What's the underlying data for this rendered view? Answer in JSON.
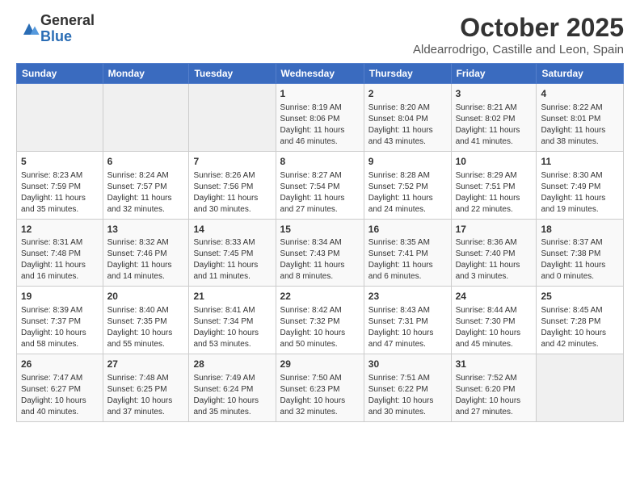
{
  "logo": {
    "general": "General",
    "blue": "Blue"
  },
  "title": "October 2025",
  "subtitle": "Aldearrodrigo, Castille and Leon, Spain",
  "headers": [
    "Sunday",
    "Monday",
    "Tuesday",
    "Wednesday",
    "Thursday",
    "Friday",
    "Saturday"
  ],
  "weeks": [
    [
      {
        "day": "",
        "content": ""
      },
      {
        "day": "",
        "content": ""
      },
      {
        "day": "",
        "content": ""
      },
      {
        "day": "1",
        "content": "Sunrise: 8:19 AM\nSunset: 8:06 PM\nDaylight: 11 hours and 46 minutes."
      },
      {
        "day": "2",
        "content": "Sunrise: 8:20 AM\nSunset: 8:04 PM\nDaylight: 11 hours and 43 minutes."
      },
      {
        "day": "3",
        "content": "Sunrise: 8:21 AM\nSunset: 8:02 PM\nDaylight: 11 hours and 41 minutes."
      },
      {
        "day": "4",
        "content": "Sunrise: 8:22 AM\nSunset: 8:01 PM\nDaylight: 11 hours and 38 minutes."
      }
    ],
    [
      {
        "day": "5",
        "content": "Sunrise: 8:23 AM\nSunset: 7:59 PM\nDaylight: 11 hours and 35 minutes."
      },
      {
        "day": "6",
        "content": "Sunrise: 8:24 AM\nSunset: 7:57 PM\nDaylight: 11 hours and 32 minutes."
      },
      {
        "day": "7",
        "content": "Sunrise: 8:26 AM\nSunset: 7:56 PM\nDaylight: 11 hours and 30 minutes."
      },
      {
        "day": "8",
        "content": "Sunrise: 8:27 AM\nSunset: 7:54 PM\nDaylight: 11 hours and 27 minutes."
      },
      {
        "day": "9",
        "content": "Sunrise: 8:28 AM\nSunset: 7:52 PM\nDaylight: 11 hours and 24 minutes."
      },
      {
        "day": "10",
        "content": "Sunrise: 8:29 AM\nSunset: 7:51 PM\nDaylight: 11 hours and 22 minutes."
      },
      {
        "day": "11",
        "content": "Sunrise: 8:30 AM\nSunset: 7:49 PM\nDaylight: 11 hours and 19 minutes."
      }
    ],
    [
      {
        "day": "12",
        "content": "Sunrise: 8:31 AM\nSunset: 7:48 PM\nDaylight: 11 hours and 16 minutes."
      },
      {
        "day": "13",
        "content": "Sunrise: 8:32 AM\nSunset: 7:46 PM\nDaylight: 11 hours and 14 minutes."
      },
      {
        "day": "14",
        "content": "Sunrise: 8:33 AM\nSunset: 7:45 PM\nDaylight: 11 hours and 11 minutes."
      },
      {
        "day": "15",
        "content": "Sunrise: 8:34 AM\nSunset: 7:43 PM\nDaylight: 11 hours and 8 minutes."
      },
      {
        "day": "16",
        "content": "Sunrise: 8:35 AM\nSunset: 7:41 PM\nDaylight: 11 hours and 6 minutes."
      },
      {
        "day": "17",
        "content": "Sunrise: 8:36 AM\nSunset: 7:40 PM\nDaylight: 11 hours and 3 minutes."
      },
      {
        "day": "18",
        "content": "Sunrise: 8:37 AM\nSunset: 7:38 PM\nDaylight: 11 hours and 0 minutes."
      }
    ],
    [
      {
        "day": "19",
        "content": "Sunrise: 8:39 AM\nSunset: 7:37 PM\nDaylight: 10 hours and 58 minutes."
      },
      {
        "day": "20",
        "content": "Sunrise: 8:40 AM\nSunset: 7:35 PM\nDaylight: 10 hours and 55 minutes."
      },
      {
        "day": "21",
        "content": "Sunrise: 8:41 AM\nSunset: 7:34 PM\nDaylight: 10 hours and 53 minutes."
      },
      {
        "day": "22",
        "content": "Sunrise: 8:42 AM\nSunset: 7:32 PM\nDaylight: 10 hours and 50 minutes."
      },
      {
        "day": "23",
        "content": "Sunrise: 8:43 AM\nSunset: 7:31 PM\nDaylight: 10 hours and 47 minutes."
      },
      {
        "day": "24",
        "content": "Sunrise: 8:44 AM\nSunset: 7:30 PM\nDaylight: 10 hours and 45 minutes."
      },
      {
        "day": "25",
        "content": "Sunrise: 8:45 AM\nSunset: 7:28 PM\nDaylight: 10 hours and 42 minutes."
      }
    ],
    [
      {
        "day": "26",
        "content": "Sunrise: 7:47 AM\nSunset: 6:27 PM\nDaylight: 10 hours and 40 minutes."
      },
      {
        "day": "27",
        "content": "Sunrise: 7:48 AM\nSunset: 6:25 PM\nDaylight: 10 hours and 37 minutes."
      },
      {
        "day": "28",
        "content": "Sunrise: 7:49 AM\nSunset: 6:24 PM\nDaylight: 10 hours and 35 minutes."
      },
      {
        "day": "29",
        "content": "Sunrise: 7:50 AM\nSunset: 6:23 PM\nDaylight: 10 hours and 32 minutes."
      },
      {
        "day": "30",
        "content": "Sunrise: 7:51 AM\nSunset: 6:22 PM\nDaylight: 10 hours and 30 minutes."
      },
      {
        "day": "31",
        "content": "Sunrise: 7:52 AM\nSunset: 6:20 PM\nDaylight: 10 hours and 27 minutes."
      },
      {
        "day": "",
        "content": ""
      }
    ]
  ]
}
